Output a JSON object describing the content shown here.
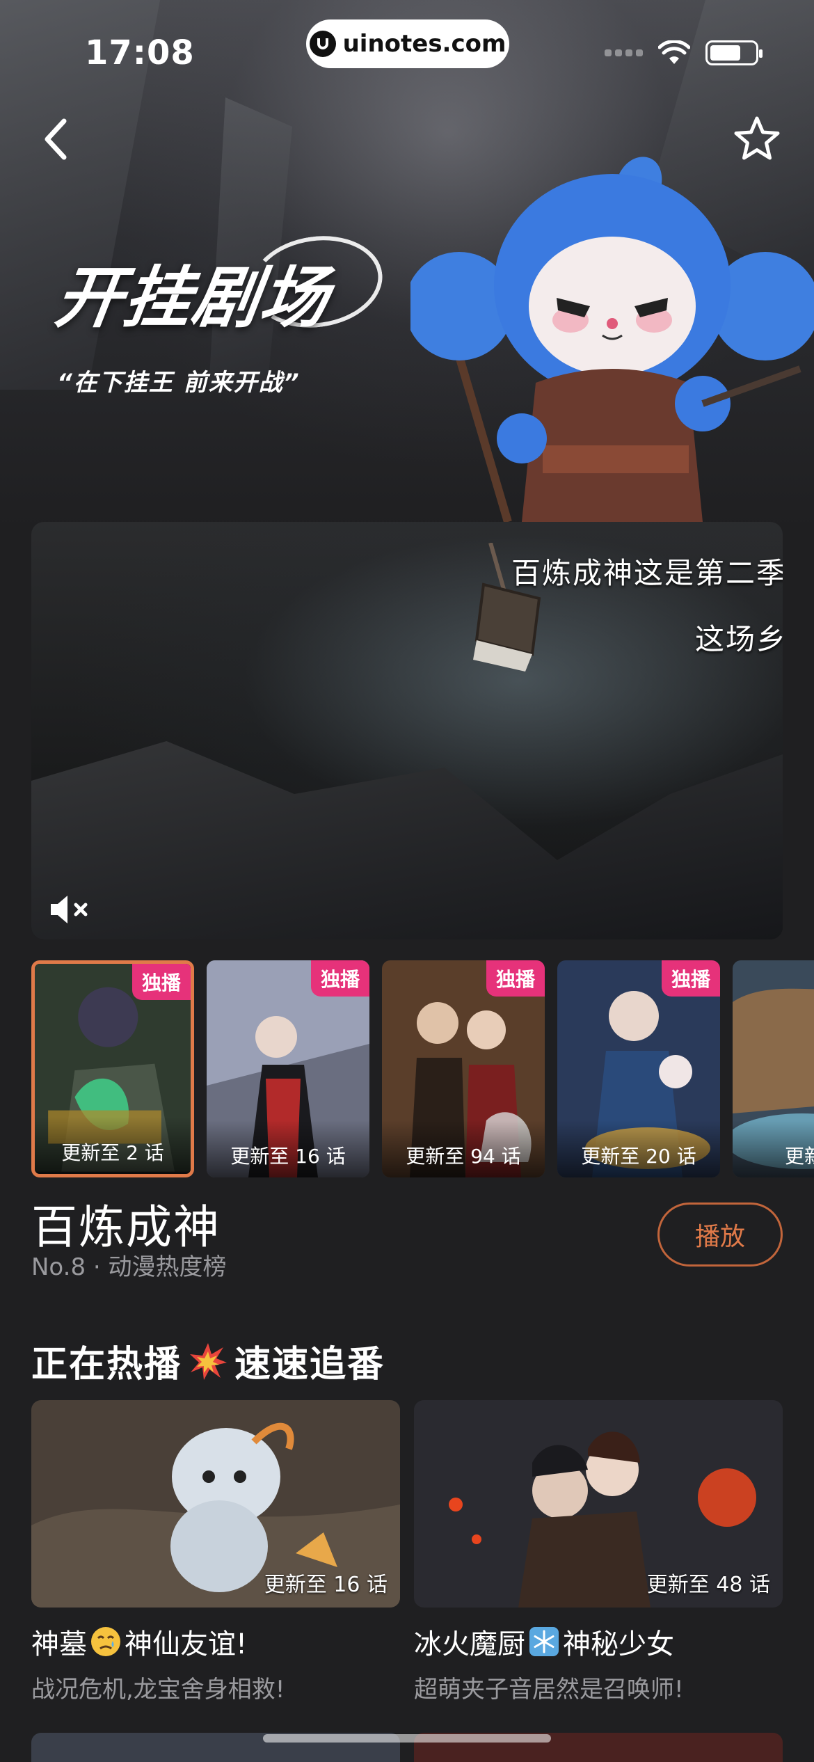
{
  "status_bar": {
    "time": "17:08",
    "url": "uinotes.com"
  },
  "hero": {
    "brand": "开挂剧场",
    "tagline": "“在下挂王 前来开战”"
  },
  "video": {
    "subtitle_line1": "百炼成神这是第二季",
    "subtitle_line2": "这场乡"
  },
  "episodes": [
    {
      "badge": "独播",
      "update": "更新至 2 话",
      "active": true
    },
    {
      "badge": "独播",
      "update": "更新至 16 话",
      "active": false
    },
    {
      "badge": "独播",
      "update": "更新至 94 话",
      "active": false
    },
    {
      "badge": "独播",
      "update": "更新至 20 话",
      "active": false
    },
    {
      "badge": "",
      "update": "更新至",
      "active": false
    }
  ],
  "show": {
    "title": "百炼成神",
    "meta": "No.8 · 动漫热度榜",
    "play_label": "播放"
  },
  "section": {
    "title_left": "正在热播",
    "title_right": "速速追番"
  },
  "cards": [
    {
      "update": "更新至 16 话",
      "title_a": "神墓",
      "title_b": "神仙友谊!",
      "subtitle": "战况危机,龙宝舍身相救!"
    },
    {
      "update": "更新至 48 话",
      "title_a": "冰火魔厨",
      "title_b": "神秘少女",
      "subtitle": "超萌夹子音居然是召唤师!"
    }
  ],
  "colors": {
    "accent": "#e07a49",
    "badge": "#e6327a",
    "background": "#1f1f21"
  }
}
